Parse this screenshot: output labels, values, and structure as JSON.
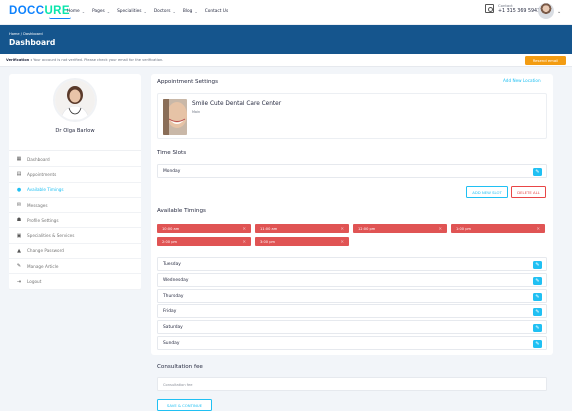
{
  "header": {
    "logo_part1": "DOCC",
    "logo_part2": "URE",
    "nav": [
      "Home",
      "Pages",
      "Specialities",
      "Doctors",
      "Blog",
      "Contact Us"
    ],
    "contact_label": "Contact",
    "contact_number": "+1 315 369 5943"
  },
  "breadcrumb": {
    "path": "Home / Dashboard",
    "title": "Dashboard"
  },
  "verification": {
    "label": "Verification :",
    "message": "Your account is not verified. Please check your email for the verification.",
    "resend_label": "Resend email"
  },
  "sidebar": {
    "doctor_name": "Dr Olga Barlow",
    "items": [
      {
        "label": "Dashboard",
        "icon": "dashboard-icon"
      },
      {
        "label": "Appointments",
        "icon": "calendar-icon"
      },
      {
        "label": "Available Timings",
        "icon": "clock-icon",
        "active": true
      },
      {
        "label": "Messages",
        "icon": "messages-icon"
      },
      {
        "label": "Profile Settings",
        "icon": "user-settings-icon"
      },
      {
        "label": "Specialities & Services",
        "icon": "briefcase-icon"
      },
      {
        "label": "Change Password",
        "icon": "lock-icon"
      },
      {
        "label": "Manage Article",
        "icon": "pen-icon"
      },
      {
        "label": "Logout",
        "icon": "logout-icon"
      }
    ]
  },
  "appointment": {
    "title": "Appointment Settings",
    "add_location": "Add New Location",
    "clinic_name": "Smile Cute Dental Care Center",
    "clinic_sub": "Main"
  },
  "time_slots": {
    "title": "Time Slots",
    "selected_day": "Monday",
    "add_slot": "ADD NEW SLOT",
    "delete_all": "DELETE ALL"
  },
  "available_timings": {
    "title": "Available Timings",
    "slots": [
      "10:00 am",
      "11:00 am",
      "12:00 pm",
      "1:00 pm",
      "2:00 pm",
      "3:00 pm"
    ]
  },
  "days": [
    "Tuesday",
    "Wednesday",
    "Thursday",
    "Friday",
    "Saturday",
    "Sunday"
  ],
  "consultation": {
    "title": "Consultation fee",
    "placeholder": "Consultation fee",
    "save_label": "SAVE & CONTINUE"
  },
  "colors": {
    "accent": "#20c0f3",
    "header_band": "#15558d",
    "chip": "#e05454",
    "warning": "#f39c12"
  }
}
